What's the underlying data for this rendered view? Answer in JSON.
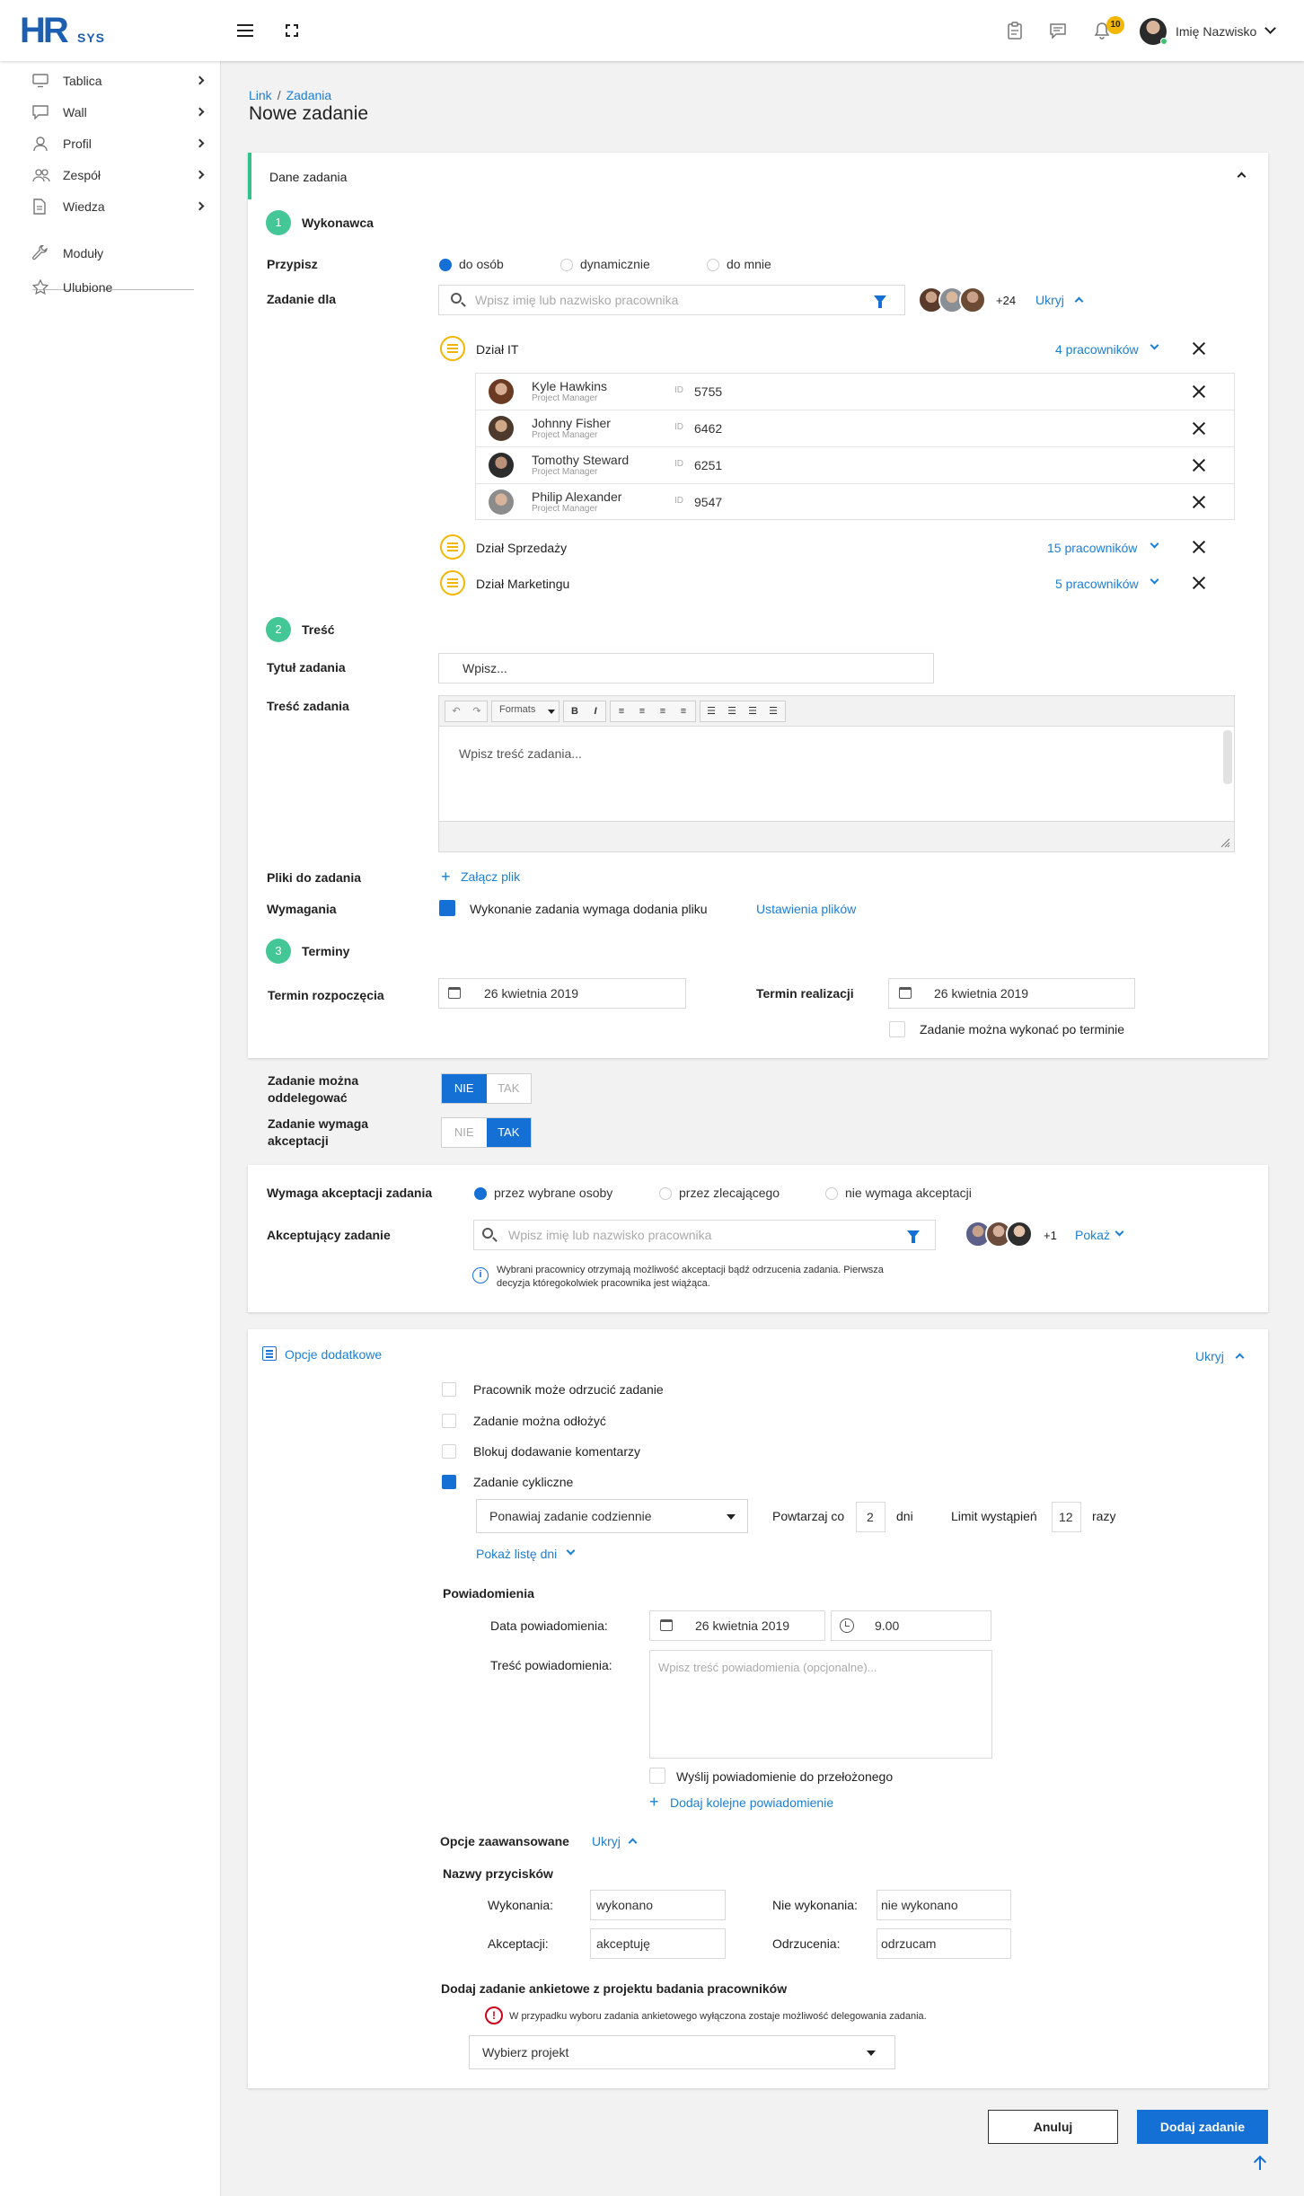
{
  "header": {
    "logo_main": "HR",
    "logo_sub": "SYS",
    "notification_count": "10",
    "user_name": "Imię Nazwisko"
  },
  "sidebar": {
    "items": [
      {
        "label": "Tablica",
        "icon": "monitor-icon"
      },
      {
        "label": "Wall",
        "icon": "chat-icon"
      },
      {
        "label": "Profil",
        "icon": "user-icon"
      },
      {
        "label": "Zespół",
        "icon": "team-icon"
      },
      {
        "label": "Wiedza",
        "icon": "document-icon"
      },
      {
        "label": "Moduły",
        "icon": "wrench-icon"
      },
      {
        "label": "Ulubione",
        "icon": "star-icon"
      }
    ]
  },
  "breadcrumb": {
    "link": "Link",
    "separator": "/",
    "current": "Zadania"
  },
  "page_title": "Nowe zadanie",
  "task_card": {
    "section_title": "Dane zadania",
    "step1": {
      "number": "1",
      "title": "Wykonawca"
    },
    "assign_label": "Przypisz",
    "assign_options": [
      "do osób",
      "dynamicznie",
      "do mnie"
    ],
    "task_for_label": "Zadanie dla",
    "search_placeholder": "Wpisz imię lub nazwisko pracownika",
    "more_count": "+24",
    "hide_label": "Ukryj",
    "groups": [
      {
        "name": "Dział IT",
        "count": "4 pracowników"
      },
      {
        "name": "Dział Sprzedaży",
        "count": "15 pracowników"
      },
      {
        "name": "Dział Marketingu",
        "count": "5 pracowników"
      }
    ],
    "employees": [
      {
        "name": "Kyle Hawkins",
        "role": "Project Manager",
        "id_label": "ID",
        "id": "5755"
      },
      {
        "name": "Johnny Fisher",
        "role": "Project Manager",
        "id_label": "ID",
        "id": "6462"
      },
      {
        "name": "Tomothy Steward",
        "role": "Project Manager",
        "id_label": "ID",
        "id": "6251"
      },
      {
        "name": "Philip Alexander",
        "role": "Project Manager",
        "id_label": "ID",
        "id": "9547"
      }
    ],
    "step2": {
      "number": "2",
      "title": "Treść"
    },
    "title_label": "Tytuł zadania",
    "title_placeholder": "Wpisz...",
    "content_label": "Treść zadania",
    "editor_formats": "Formats",
    "editor_placeholder": "Wpisz treść zadania...",
    "files_label": "Pliki do zadania",
    "attach_label": "Załącz plik",
    "requirements_label": "Wymagania",
    "requires_file_label": "Wykonanie zadania wymaga dodania pliku",
    "file_settings_link": "Ustawienia plików",
    "step3": {
      "number": "3",
      "title": "Terminy"
    },
    "start_label": "Termin rozpoczęcia",
    "start_date": "26 kwietnia 2019",
    "due_label": "Termin realizacji",
    "due_date": "26 kwietnia 2019",
    "after_due_label": "Zadanie można wykonać po terminie"
  },
  "toggles": [
    {
      "label": "Zadanie można oddelegować",
      "off": "NIE",
      "on": "TAK",
      "value": "NIE"
    },
    {
      "label": "Zadanie wymaga akceptacji",
      "off": "NIE",
      "on": "TAK",
      "value": "TAK"
    }
  ],
  "acceptance_card": {
    "requires_label": "Wymaga akceptacji zadania",
    "options": [
      "przez wybrane osoby",
      "przez zlecającego",
      "nie wymaga akceptacji"
    ],
    "acceptor_label": "Akceptujący zadanie",
    "search_placeholder": "Wpisz imię lub nazwisko pracownika",
    "more_count": "+1",
    "show_label": "Pokaż",
    "info_text": "Wybrani pracownicy otrzymają możliwość akceptacji bądź odrzucenia zadania. Pierwsza decyzja któregokolwiek pracownika jest wiążąca."
  },
  "options_card": {
    "title": "Opcje dodatkowe",
    "hide_label": "Ukryj",
    "checks": [
      {
        "label": "Pracownik może odrzucić zadanie",
        "checked": false
      },
      {
        "label": "Zadanie można odłożyć",
        "checked": false
      },
      {
        "label": "Blokuj dodawanie komentarzy",
        "checked": false
      },
      {
        "label": "Zadanie cykliczne",
        "checked": true
      }
    ],
    "repeat_select": "Ponawiaj zadanie codziennie",
    "repeat_every_label": "Powtarzaj co",
    "repeat_every_value": "2",
    "repeat_unit": "dni",
    "limit_label": "Limit wystąpień",
    "limit_value": "12",
    "limit_unit": "razy",
    "show_days": "Pokaż listę dni",
    "notifications_title": "Powiadomienia",
    "notif_date_label": "Data powiadomienia:",
    "notif_date": "26 kwietnia 2019",
    "notif_time": "9.00",
    "notif_content_label": "Treść powiadomienia:",
    "notif_content_placeholder": "Wpisz treść powiadomienia (opcjonalne)...",
    "notify_supervisor": "Wyślij powiadomienie do przełożonego",
    "add_notification": "Dodaj kolejne powiadomienie",
    "advanced_label": "Opcje zaawansowane",
    "advanced_hide": "Ukryj",
    "button_names_title": "Nazwy przycisków",
    "done_label": "Wykonania:",
    "done_value": "wykonano",
    "not_done_label": "Nie wykonania:",
    "not_done_value": "nie wykonano",
    "accept_label": "Akceptacji:",
    "accept_value": "akceptuję",
    "reject_label": "Odrzucenia:",
    "reject_value": "odrzucam",
    "survey_title": "Dodaj zadanie ankietowe z projektu badania pracowników",
    "survey_warning": "W przypadku wyboru zadania ankietowego wyłączona zostaje możliwość delegowania zadania.",
    "project_select": "Wybierz projekt"
  },
  "footer": {
    "cancel": "Anuluj",
    "submit": "Dodaj zadanie"
  }
}
